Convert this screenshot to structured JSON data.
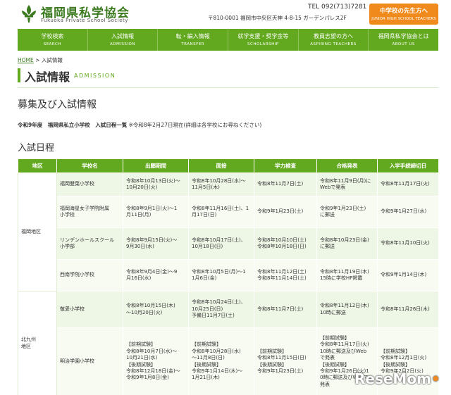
{
  "header": {
    "logo_title": "福岡県私学協会",
    "logo_sub": "Fukuoka Private School Society",
    "tel": "TEL 092(713)7281",
    "address": "〒810-0001 福岡市中央区天神 4-8-15 ガーデンパレス2F",
    "teacher_button": {
      "label": "中学校の先生方へ",
      "sub": "JUNIOR HIGH SCHOOL TEACHERS"
    }
  },
  "nav": [
    {
      "ja": "学校検索",
      "en": "SEARCH"
    },
    {
      "ja": "入試情報",
      "en": "ADMISSION"
    },
    {
      "ja": "転・編入情報",
      "en": "TRANSFER"
    },
    {
      "ja": "就学支援・奨学金等",
      "en": "SCHOLARSHIP"
    },
    {
      "ja": "教員志望の方へ",
      "en": "ASPIRING TEACHERS"
    },
    {
      "ja": "福岡県私学協会とは",
      "en": "ABOUT US"
    }
  ],
  "breadcrumb": {
    "home": "HOME",
    "sep": " > ",
    "current": "入試情報"
  },
  "page_title": "入試情報",
  "page_title_en": "ADMISSION",
  "section_title": "募集及び入試情報",
  "intro": {
    "bold": "令和9年度　福岡県私立小学校　入試日程一覧",
    "note": " ※令和8年2月27日現在(詳細は各学校にお尋ねください)"
  },
  "schedule_title": "入試日程",
  "table": {
    "headers": [
      "地区",
      "学校名",
      "出願期間",
      "面接",
      "学力検査",
      "合格発表",
      "入学手続締切日"
    ],
    "rows": [
      {
        "area": "福岡地区",
        "school": "福岡雙葉小学校",
        "apply": "令和8年10月13日(火)～\n10月20日(火)",
        "interview": "令和8年10月28日(水)～\n11月5日(木)",
        "exam": "令和8年11月7日(土)",
        "result": "令和8年11月9日(月)に\nWebで発表",
        "deadline": "令和8年11月17日(火)"
      },
      {
        "school": "福岡海星女子学院附属\n小学校",
        "apply": "令和8年9月1日(火)～1\n月11日(月)",
        "interview": "令和8年11月16日(土)、1\n月17日(日)",
        "exam": "令和9年1月23日(土)",
        "result": "令和9年1月23日(土)\nに郵送",
        "deadline": "令和9年1月27日(水)"
      },
      {
        "school": "リンデンホールスクール\n小学部",
        "apply": "令和8年9月15日(火)～\n9月30日(水)",
        "interview": "令和8年10月17日(土)、\n10月18日(日)",
        "exam": "令和8年10月10日(土)\n令和8年10月18日(日)",
        "result": "令和8年10月23日(金)\nに郵送",
        "deadline": "令和8年11月10日(火)"
      },
      {
        "school": "西南学院小学校",
        "apply": "令和8年9月4日(金)～9\n月16日(水)",
        "interview": "令和8年10月5日(月)～1\n1月6日(金)",
        "exam": "令和8年11月12日(土)\n令和8年11月14日(土)",
        "result": "令和8年11月19日(木)\n15時に学校HP掲載",
        "deadline": "令和9年1月14日(木)"
      },
      {
        "area": "北九州\n地区",
        "school": "敬愛小学校",
        "apply": "令和8年10月15日(木)\n～10月20日(火)",
        "interview": "令和8年10月24日(土)、\n10月25日(日)\n予備日11月7日(土)",
        "exam": "令和8年11月7日(土)",
        "result": "令和8年11月12日(木)\n10時に郵送",
        "deadline": "令和8年11月26日(木)"
      },
      {
        "school": "明治学園小学校",
        "apply": "【前期試験】\n令和8年10月7日(水)～\n10月21日(水)\n【後期試験】\n令和8年12月18日(金)～\n令和9年1月8日(金)",
        "interview": "【前期試験】\n令和8年10月28日(水)\n～11月8日(日)\n【後期試験】\n令和9年1月14日(木)～\n1月21日(木)",
        "exam": "【前期試験】\n令和8年11月15日(日)\n【後期試験】\n令和9年1月23日(土)",
        "result": "【前期試験】\n令和8年11月17日(火)\n10時に郵送及びWeb\nで発表\n【後期試験】\n令和9年1月26日(火)1\n0時に郵送及びWebで\n発表",
        "deadline": "【前期試験】\n令和8年12月1日(火)\n【後期試験】\n令和9年2月2日(火)"
      }
    ]
  },
  "watermark": {
    "text": "ReseMom",
    "dot": "•"
  },
  "colors": {
    "green": "#63a91f",
    "dark_green": "#3b7a1f",
    "orange": "#f08a1c",
    "row_light": "#eef6e6"
  }
}
